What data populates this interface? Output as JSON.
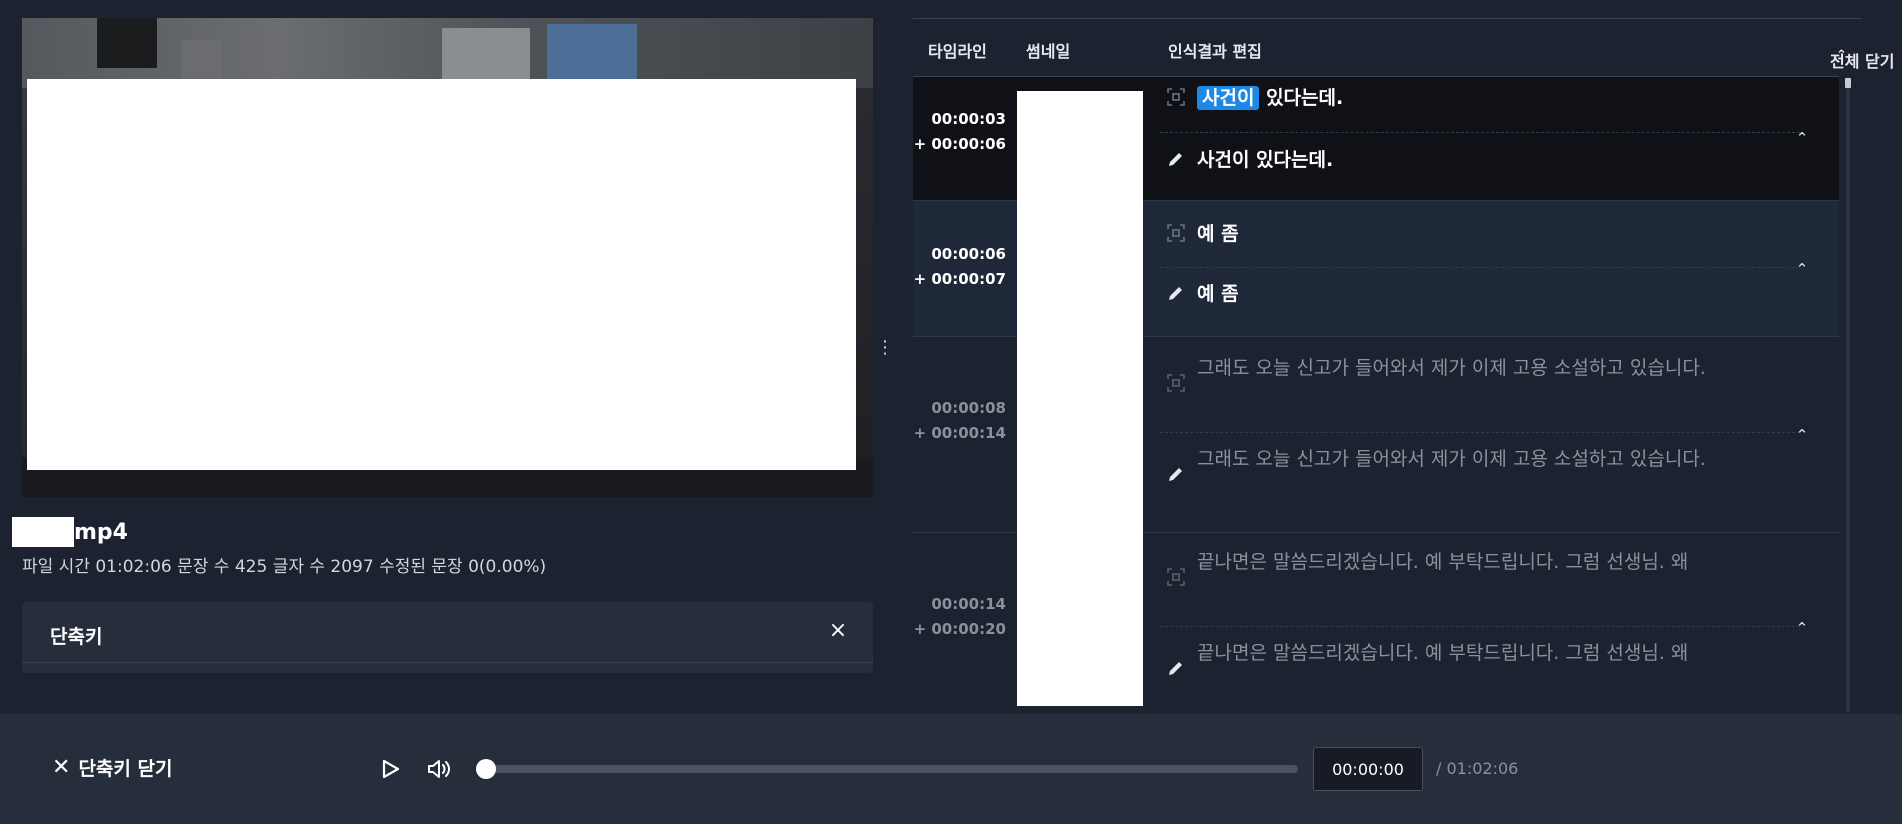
{
  "player": {
    "file_name_suffix": "mp4",
    "meta_text": "파일 시간 01:02:06 문장 수 425 글자 수 2097 수정된 문장 0(0.00%)",
    "divider_icon": "⋮",
    "progress_fraction": 0.0,
    "current_time": "00:00:00",
    "total_time": "/ 01:02:06"
  },
  "shortcut_panel": {
    "title": "단축키",
    "close_icon": "×"
  },
  "table": {
    "headers": {
      "timeline": "타임라인",
      "thumbnail": "썸네일",
      "edit": "인식결과 편집",
      "collapse_all": "전체 닫기",
      "collapse_icon": "⌃"
    },
    "rows": [
      {
        "start": "00:00:03",
        "duration": "+ 00:00:06",
        "recognized_highlight": "사건이",
        "recognized_rest": " 있다는데.",
        "edited": "사건이 있다는데.",
        "state": "current"
      },
      {
        "start": "00:00:06",
        "duration": "+ 00:00:07",
        "recognized": "예 좀",
        "edited": "예 좀",
        "state": "selected"
      },
      {
        "start": "00:00:08",
        "duration": "+ 00:00:14",
        "recognized": "그래도 오늘 신고가 들어와서 제가 이제 고용 소설하고 있습니다.",
        "edited": "그래도 오늘 신고가 들어와서 제가 이제 고용 소설하고 있습니다.",
        "state": "normal"
      },
      {
        "start": "00:00:14",
        "duration": "+ 00:00:20",
        "recognized": "끝나면은 말씀드리겠습니다. 예 부탁드립니다. 그럼 선생님. 왜",
        "edited": "끝나면은 말씀드리겠습니다. 예 부탁드립니다. 그럼 선생님. 왜",
        "state": "normal"
      }
    ]
  },
  "bottom_bar": {
    "close_shortcut_label": "단축키 닫기",
    "close_icon": "✕"
  },
  "icons": {
    "recognized": "recognize-icon",
    "edited": "pencil-icon",
    "play": "play-icon",
    "volume": "volume-icon",
    "chevron": "chevron-up-icon"
  },
  "colors": {
    "background": "#1c2230",
    "panel": "#262d3b",
    "highlight": "#1e88e5",
    "current_row": "#0f1116",
    "selected_row": "#1f2838",
    "dim_text": "#8a909c"
  }
}
